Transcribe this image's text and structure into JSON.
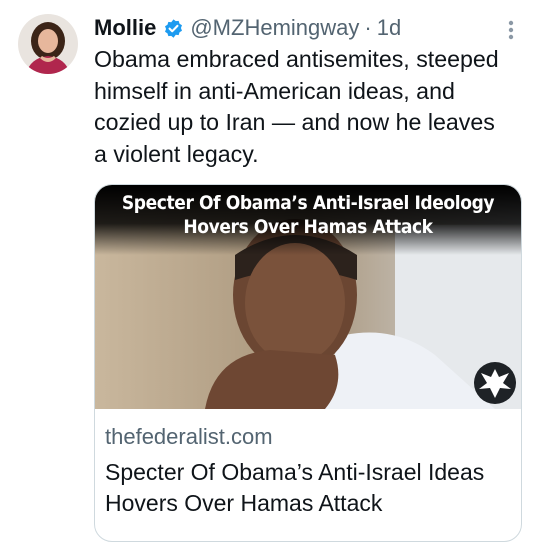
{
  "author": {
    "name": "Mollie",
    "handle": "@MZHemingway",
    "separator": "·",
    "time": "1d",
    "verified_icon": "verified-badge-icon",
    "verified_color": "#1d9bf0"
  },
  "tweet": {
    "text": "Obama embraced antisemites, steeped himself in anti-American ideas, and cozied up to Iran — and now he leaves a violent legacy."
  },
  "card": {
    "image_headline_line1": "Specter Of Obama’s Anti-Israel Ideology",
    "image_headline_line2": "Hovers Over Hamas Attack",
    "domain": "thefederalist.com",
    "title": "Specter Of Obama’s Anti-Israel Ideas Hovers Over Hamas Attack",
    "emblem_icon": "eagle-logo-icon"
  },
  "menu": {
    "icon": "more-vertical-icon"
  },
  "colors": {
    "text_primary": "#0f1419",
    "text_secondary": "#536471",
    "card_border": "#cfd9de"
  }
}
